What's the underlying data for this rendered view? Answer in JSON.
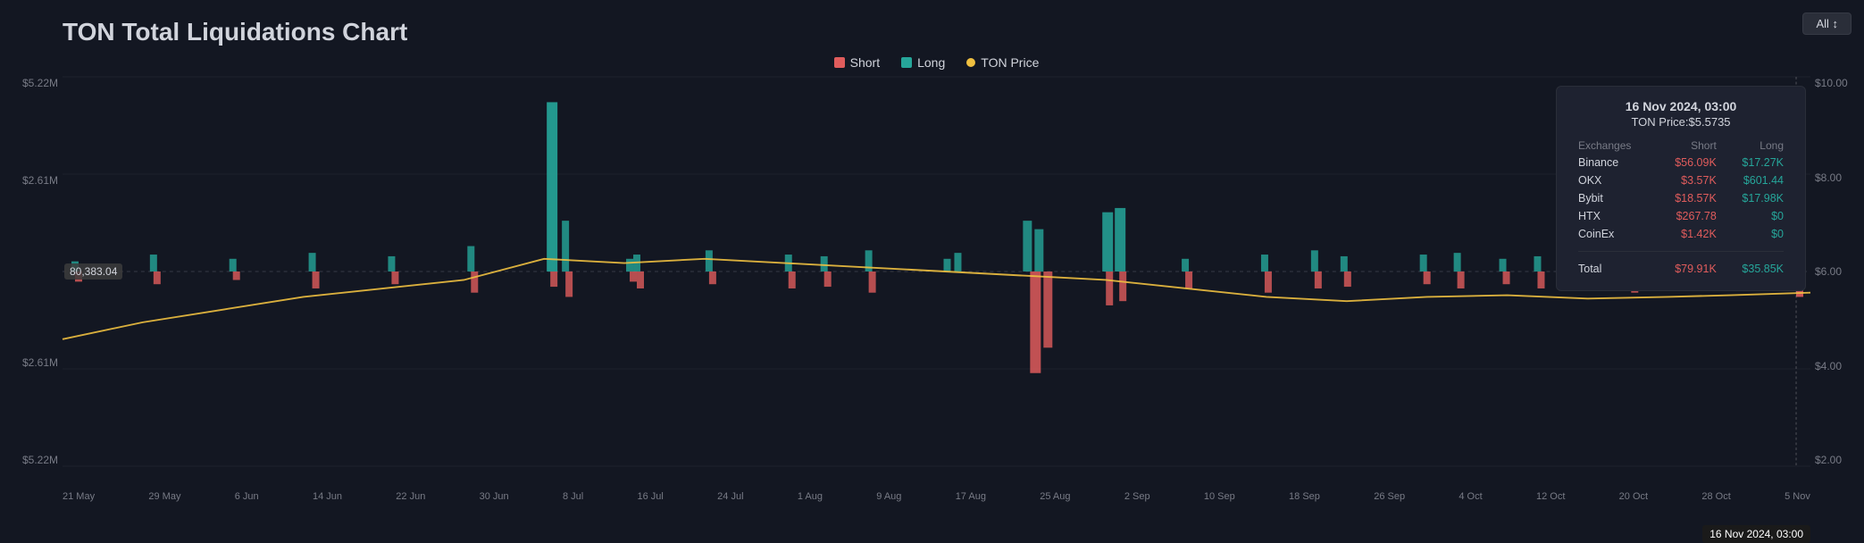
{
  "title": "TON Total Liquidations Chart",
  "all_button": "All ↕",
  "legend": {
    "short_label": "Short",
    "long_label": "Long",
    "price_label": "TON Price"
  },
  "y_axis_left": [
    "$5.22M",
    "$2.61M",
    "",
    "$2.61M",
    "$5.22M"
  ],
  "y_axis_right": [
    "$10.00",
    "$8.00",
    "$6.00",
    "$4.00",
    "$2.00"
  ],
  "x_axis_labels": [
    "21 May",
    "29 May",
    "6 Jun",
    "14 Jun",
    "22 Jun",
    "30 Jun",
    "8 Jul",
    "16 Jul",
    "24 Jul",
    "1 Aug",
    "9 Aug",
    "17 Aug",
    "25 Aug",
    "2 Sep",
    "10 Sep",
    "18 Sep",
    "26 Sep",
    "4 Oct",
    "12 Oct",
    "20 Oct",
    "28 Oct",
    "5 Nov",
    "16 Nov 2024, 03:00"
  ],
  "center_label": "80,383.04",
  "tooltip": {
    "datetime": "16 Nov 2024, 03:00",
    "ton_price_label": "TON Price:",
    "ton_price_value": "$5.5735",
    "headers": [
      "Exchanges",
      "Short",
      "Long"
    ],
    "rows": [
      {
        "exchange": "Binance",
        "short": "$56.09K",
        "long": "$17.27K"
      },
      {
        "exchange": "OKX",
        "short": "$3.57K",
        "long": "$601.44"
      },
      {
        "exchange": "Bybit",
        "short": "$18.57K",
        "long": "$17.98K"
      },
      {
        "exchange": "HTX",
        "short": "$267.78",
        "long": "$0"
      },
      {
        "exchange": "CoinEx",
        "short": "$1.42K",
        "long": "$0"
      }
    ],
    "total_label": "Total",
    "total_short": "$79.91K",
    "total_long": "$35.85K"
  },
  "timestamp_badge": "16 Nov 2024, 03:00"
}
